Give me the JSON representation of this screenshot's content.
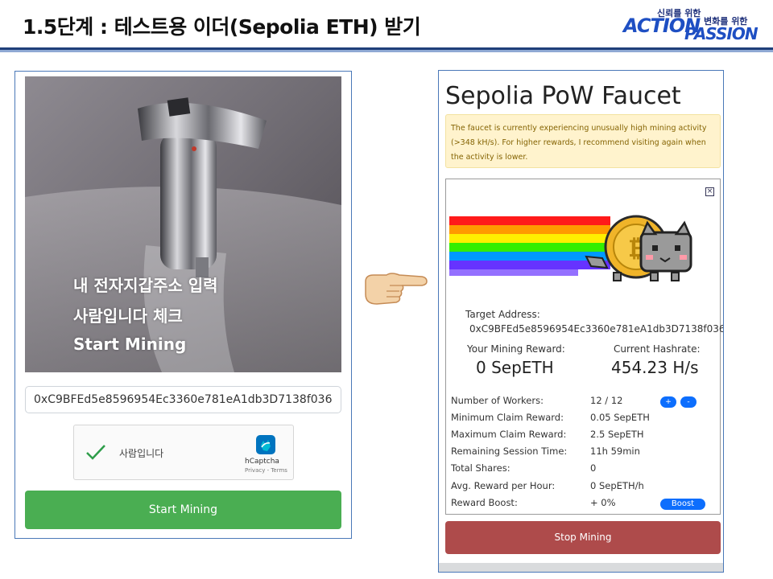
{
  "slide": {
    "title": "1.5단계 : 테스트용 이더(Sepolia ETH) 받기",
    "logo": {
      "tagline_1": "신뢰를 위한",
      "tagline_2": "변화를 위한",
      "word_1": "ACTION",
      "word_2": "PASSION"
    }
  },
  "left_panel": {
    "instructions": [
      "내 전자지갑주소 입력",
      "사람입니다 체크",
      "Start Mining"
    ],
    "address_input": {
      "value": "0xC9BFEd5e8596954Ec3360e781eA1db3D7138f036"
    },
    "captcha": {
      "label": "사람입니다",
      "brand": "hCaptcha",
      "links": "Privacy - Terms",
      "checked": true
    },
    "start_button": "Start Mining"
  },
  "right_panel": {
    "title": "Sepolia PoW Faucet",
    "notice": "The faucet is currently experiencing unusually high mining activity (>348 kH/s). For higher rewards, I recommend visiting again when the activity is lower.",
    "close_icon": "close-icon",
    "target_label": "Target Address:",
    "target_value": "0xC9BFEd5e8596954Ec3360e781eA1db3D7138f036",
    "reward_label": "Your Mining Reward:",
    "reward_value": "0 SepETH",
    "hashrate_label": "Current Hashrate:",
    "hashrate_value": "454.23 H/s",
    "stats": [
      {
        "label": "Number of Workers:",
        "value": "12 / 12"
      },
      {
        "label": "Minimum Claim Reward:",
        "value": "0.05 SepETH"
      },
      {
        "label": "Maximum Claim Reward:",
        "value": "2.5 SepETH"
      },
      {
        "label": "Remaining Session Time:",
        "value": "11h 59min"
      },
      {
        "label": "Total Shares:",
        "value": "0"
      },
      {
        "label": "Avg. Reward per Hour:",
        "value": "0 SepETH/h"
      },
      {
        "label": "Reward Boost:",
        "value": "+ 0%"
      }
    ],
    "worker_plus": "+",
    "worker_minus": "-",
    "boost_button": "Boost",
    "stop_button": "Stop Mining"
  },
  "colors": {
    "header_rule": "#1f3f7a",
    "start_button": "#4aae52",
    "stop_button": "#ae4b4b",
    "pill_button": "#0d6efd",
    "notice_bg": "#fff3cd"
  }
}
